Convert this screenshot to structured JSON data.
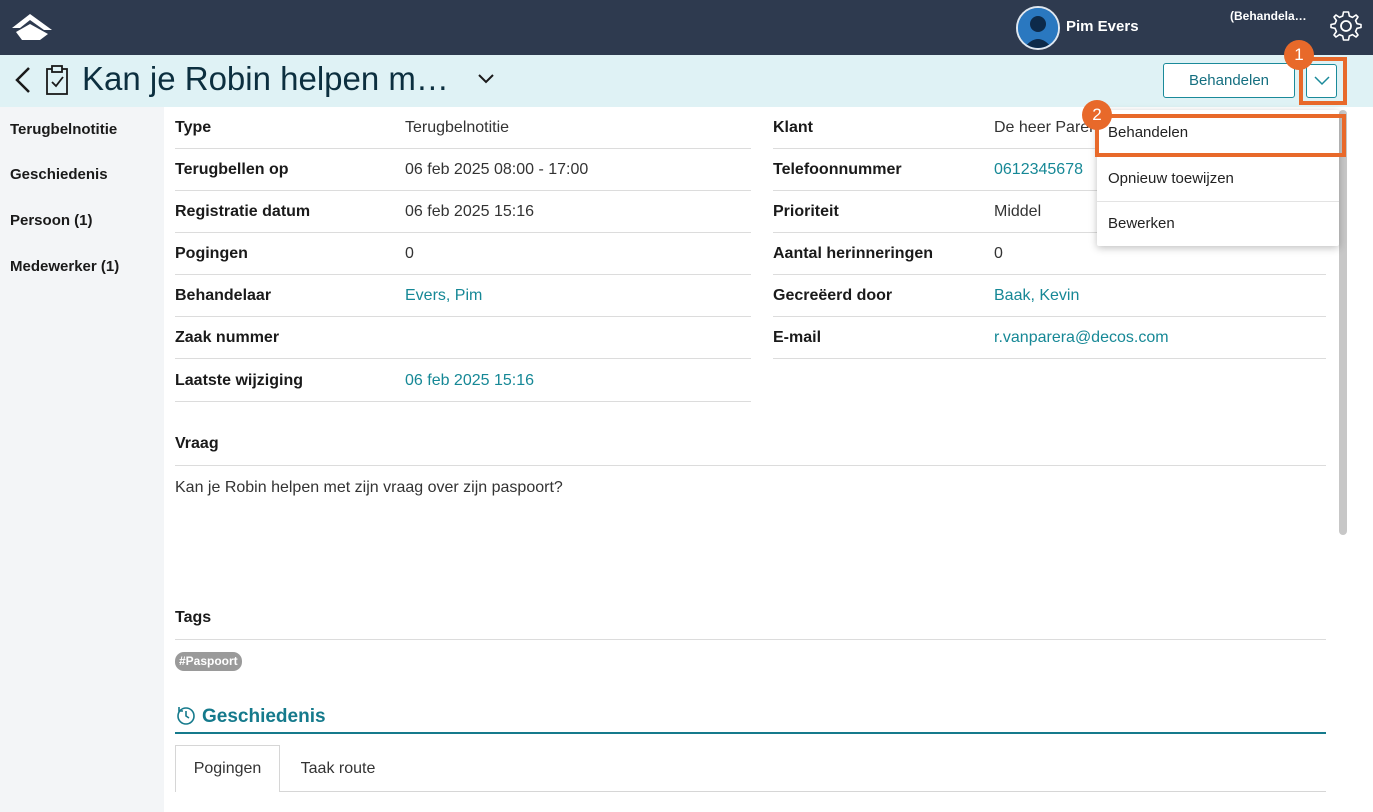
{
  "topbar": {
    "logo_icon": "house-logo-icon",
    "user_name": "Pim Evers",
    "role_text": "(Behandela…",
    "settings_icon": "gear-icon"
  },
  "header": {
    "title": "Kan je Robin helpen m…",
    "primary_button": "Behandelen",
    "dropdown_icon": "chevron-down-icon"
  },
  "sidebar": {
    "items": [
      {
        "label": "Terugbelnotitie"
      },
      {
        "label": "Geschiedenis"
      },
      {
        "label": "Persoon (1)"
      },
      {
        "label": "Medewerker (1)"
      }
    ]
  },
  "details_left": [
    {
      "label": "Type",
      "value": "Terugbelnotitie"
    },
    {
      "label": "Terugbellen op",
      "value": "06 feb 2025 08:00 - 17:00"
    },
    {
      "label": "Registratie datum",
      "value": "06 feb 2025 15:16"
    },
    {
      "label": "Pogingen",
      "value": "0"
    },
    {
      "label": "Behandelaar",
      "value": "Evers, Pim"
    },
    {
      "label": "Zaak nummer",
      "value": ""
    },
    {
      "label": "Laatste wijziging",
      "value": "06 feb 2025 15:16"
    }
  ],
  "details_right": [
    {
      "label": "Klant",
      "value": "De heer Parera"
    },
    {
      "label": "Telefoonnummer",
      "value": "0612345678"
    },
    {
      "label": "Prioriteit",
      "value": "Middel"
    },
    {
      "label": "Aantal herinneringen",
      "value": "0"
    },
    {
      "label": "Gecreëerd door",
      "value": "Baak, Kevin"
    },
    {
      "label": "E-mail",
      "value": "r.vanparera@decos.com"
    }
  ],
  "question": {
    "label": "Vraag",
    "text": "Kan je Robin helpen met zijn vraag over zijn paspoort?"
  },
  "tags": {
    "label": "Tags",
    "items": [
      "#Paspoort"
    ]
  },
  "history": {
    "title": "Geschiedenis",
    "tabs": [
      {
        "label": "Pogingen"
      },
      {
        "label": "Taak route"
      }
    ]
  },
  "dropdown_menu": {
    "items": [
      {
        "label": "Behandelen"
      },
      {
        "label": "Opnieuw toewijzen"
      },
      {
        "label": "Bewerken"
      }
    ]
  },
  "annotations": {
    "badge_1": "1",
    "badge_2": "2",
    "highlight_color": "#e8692a"
  },
  "colors": {
    "topbar": "#2e3a4f",
    "header_bg": "#dff2f5",
    "link": "#168896",
    "accent": "#157a8c"
  }
}
